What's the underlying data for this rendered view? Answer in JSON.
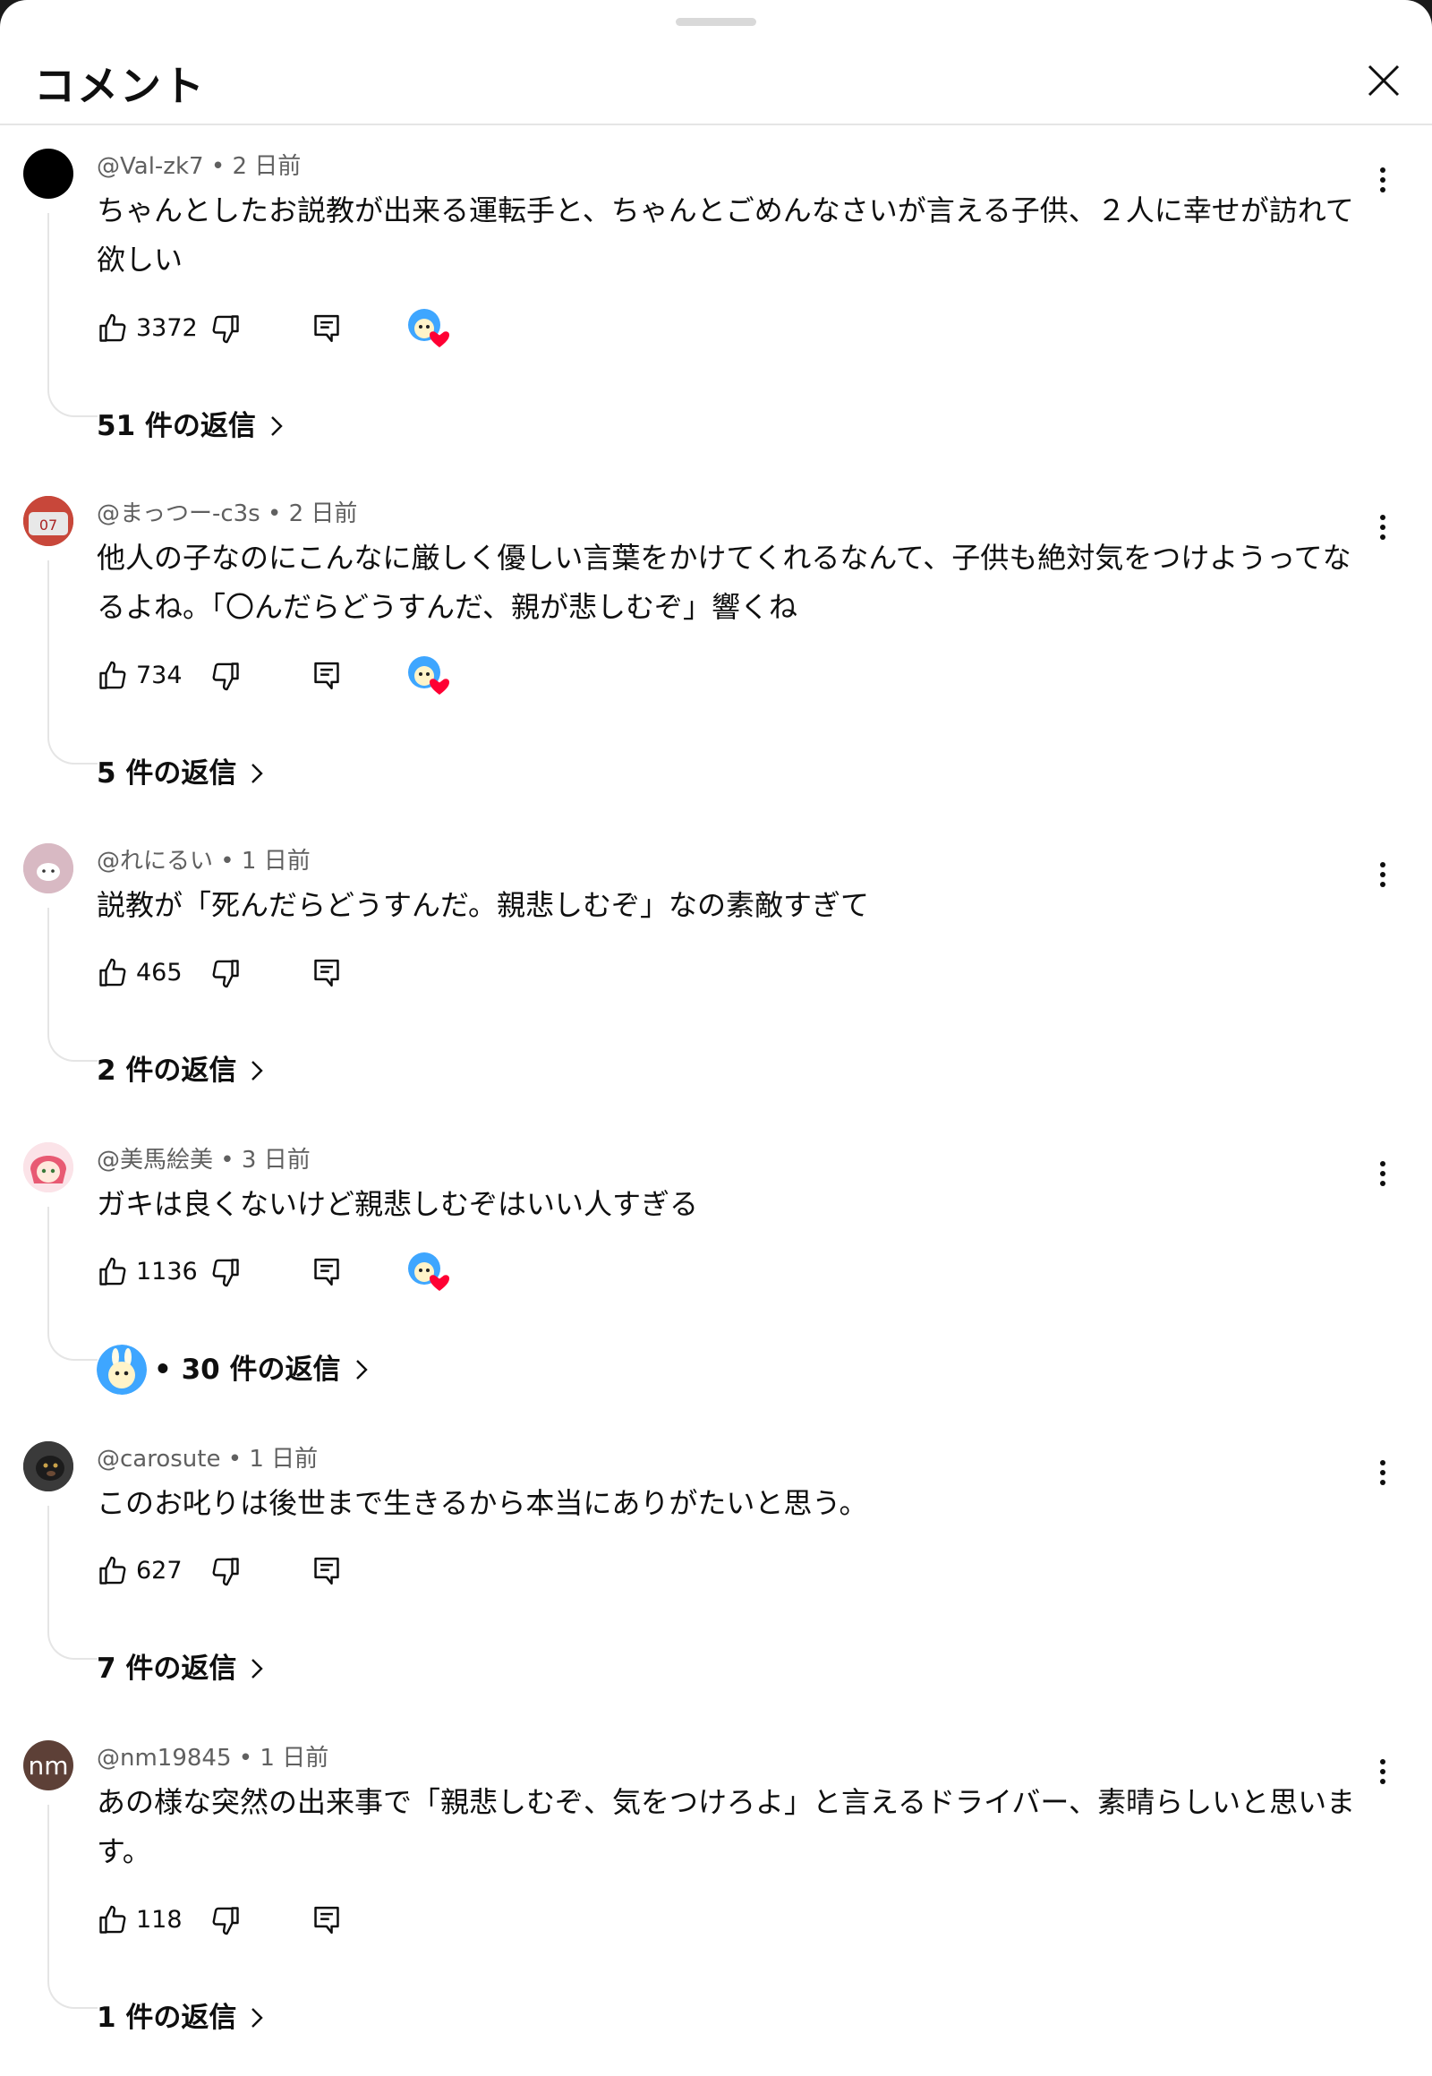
{
  "header": {
    "title": "コメント"
  },
  "icons": {
    "close": "close-icon",
    "like": "thumb-up-icon",
    "dislike": "thumb-down-icon",
    "reply": "reply-icon",
    "more": "more-vert-icon",
    "creator_heart": "creator-heart-icon"
  },
  "colors": {
    "heart": "#ff0033",
    "meta": "#606060",
    "divider": "#e5e5e5"
  },
  "comments": [
    {
      "author": "@Val-zk7",
      "time": "2 日前",
      "text": "ちゃんとしたお説教が出来る運転手と、ちゃんとごめんなさいが言える子供、２人に幸せが訪れて欲しい",
      "likes": "3372",
      "creator_heart": true,
      "replies": "51 件の返信"
    },
    {
      "author": "@まっつー-c3s",
      "time": "2 日前",
      "text": "他人の子なのにこんなに厳しく優しい言葉をかけてくれるなんて、子供も絶対気をつけようってなるよね。「〇んだらどうすんだ、親が悲しむぞ」響くね",
      "likes": "734",
      "creator_heart": true,
      "replies": "5 件の返信"
    },
    {
      "author": "@れにるい",
      "time": "1 日前",
      "text": "説教が「死んだらどうすんだ。親悲しむぞ」なの素敵すぎて",
      "likes": "465",
      "creator_heart": false,
      "replies": "2 件の返信"
    },
    {
      "author": "@美馬絵美",
      "time": "3 日前",
      "text": "ガキは良くないけど親悲しむぞはいい人すぎる",
      "likes": "1136",
      "creator_heart": true,
      "replies": "• 30 件の返信"
    },
    {
      "author": "@carosute",
      "time": "1 日前",
      "text": "このお叱りは後世まで生きるから本当にありがたいと思う。",
      "likes": "627",
      "creator_heart": false,
      "replies": "7 件の返信"
    },
    {
      "author": "@nm19845",
      "time": "1 日前",
      "avatar_text": "nm",
      "text": "あの様な突然の出来事で「親悲しむぞ、気をつけろよ」と言えるドライバー、素晴らしいと思います。",
      "likes": "118",
      "creator_heart": false,
      "replies": "1 件の返信"
    }
  ]
}
